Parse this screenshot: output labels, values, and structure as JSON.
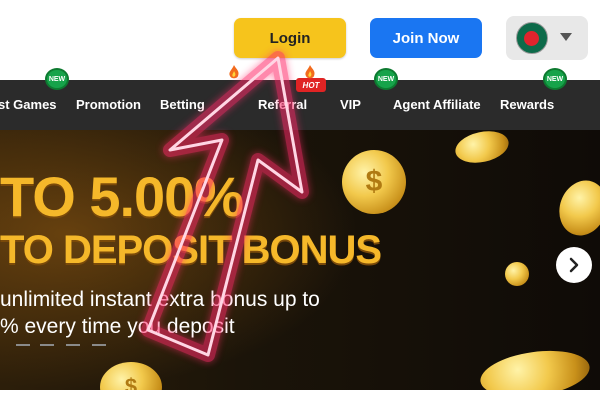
{
  "header": {
    "login_label": "Login",
    "join_label": "Join Now",
    "language_icon": "bangladesh-flag-icon"
  },
  "nav": {
    "items": [
      {
        "label": "st Games",
        "badge": "NEW"
      },
      {
        "label": "Promotion"
      },
      {
        "label": "Betting",
        "badge": "HOT"
      },
      {
        "label": "Referral"
      },
      {
        "label": "VIP",
        "badge": "NEW"
      },
      {
        "label": "Agent Affiliate"
      },
      {
        "label": "Rewards",
        "badge": "NEW"
      }
    ],
    "new_badge": "NEW",
    "hot_badge": "HOT"
  },
  "banner": {
    "title_line1": "TO 5.00%",
    "title_line2": "TO DEPOSIT BONUS",
    "description_line1": "unlimited instant extra bonus up to",
    "description_line2": "% every time you deposit",
    "coin_symbol": "$"
  },
  "colors": {
    "accent_yellow": "#f6c41c",
    "join_blue": "#1a76f2",
    "nav_bg": "#2b2b2b",
    "badge_green": "#16a34a",
    "arrow_glow": "#ff2a6a"
  }
}
